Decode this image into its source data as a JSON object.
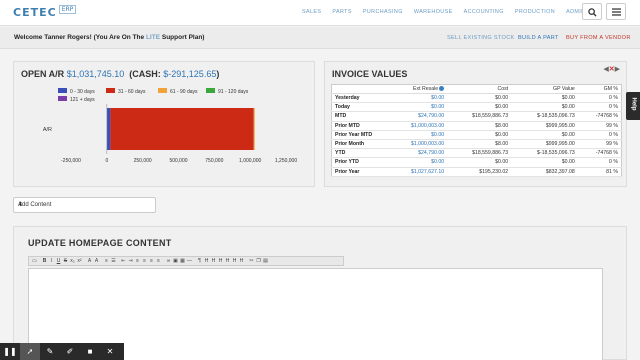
{
  "nav": {
    "logo": "CETEC",
    "logo_badge": "ERP",
    "links": [
      "SALES",
      "PARTS",
      "PURCHASING",
      "WAREHOUSE",
      "ACCOUNTING",
      "PRODUCTION",
      "ADMIN"
    ]
  },
  "welcome": {
    "prefix": "Welcome Tanner Rogers! (You Are On The ",
    "plan": "LITE",
    "suffix": " Support Plan)",
    "actions": [
      "SELL EXISTING STOCK",
      "BUILD A PART",
      "BUY FROM A VENDOR"
    ]
  },
  "ar": {
    "title_label": "OPEN A/R",
    "open_value": "$1,031,745.10",
    "cash_label": "(CASH:",
    "cash_value": "$-291,125.65",
    "cash_close": ")"
  },
  "chart_data": {
    "type": "bar",
    "orientation": "horizontal",
    "stacked": true,
    "categories": [
      "A/R"
    ],
    "series": [
      {
        "name": "0 - 30 days",
        "color": "#3b4fb8",
        "values": [
          24790
        ]
      },
      {
        "name": "31 - 60 days",
        "color": "#cc2a14",
        "values": [
          1000003
        ]
      },
      {
        "name": "61 - 90 days",
        "color": "#f2a23a",
        "values": [
          6952
        ]
      },
      {
        "name": "91 - 120 days",
        "color": "#3aa83a",
        "values": [
          0
        ]
      },
      {
        "name": "121 + days",
        "color": "#7a3fa8",
        "values": [
          0
        ]
      }
    ],
    "xlim": [
      -250000,
      1250000
    ],
    "xticks": [
      "-250,000",
      "0",
      "250,000",
      "500,000",
      "750,000",
      "1,000,000",
      "1,250,000"
    ],
    "legend": "top"
  },
  "invoice": {
    "title": "INVOICE VALUES",
    "headers": [
      "",
      "Ext Resale",
      "Cost",
      "GP Value",
      "GM %"
    ],
    "rows": [
      [
        "Yesterday",
        "$0.00",
        "$0.00",
        "$0.00",
        "0 %"
      ],
      [
        "Today",
        "$0.00",
        "$0.00",
        "$0.00",
        "0 %"
      ],
      [
        "MTD",
        "$24,790.00",
        "$18,559,886.73",
        "$-18,535,096.73",
        "-74768 %"
      ],
      [
        "Prior MTD",
        "$1,000,003.00",
        "$8.00",
        "$999,995.00",
        "99 %"
      ],
      [
        "Prior Year MTD",
        "$0.00",
        "$0.00",
        "$0.00",
        "0 %"
      ],
      [
        "Prior Month",
        "$1,000,003.00",
        "$8.00",
        "$999,995.00",
        "99 %"
      ],
      [
        "YTD",
        "$24,790.00",
        "$18,559,886.73",
        "$-18,535,096.73",
        "-74768 %"
      ],
      [
        "Prior YTD",
        "$0.00",
        "$0.00",
        "$0.00",
        "0 %"
      ],
      [
        "Prior Year",
        "$1,027,627.10",
        "$195,230.02",
        "$832,397.08",
        "81 %"
      ]
    ]
  },
  "add_content": {
    "selected": "Add Content"
  },
  "update": {
    "title": "UPDATE HOMEPAGE CONTENT"
  },
  "help": "Help",
  "colors": {
    "accent": "#2f74b5",
    "buy": "#c0392b",
    "nav_link": "#6b9cc4"
  }
}
